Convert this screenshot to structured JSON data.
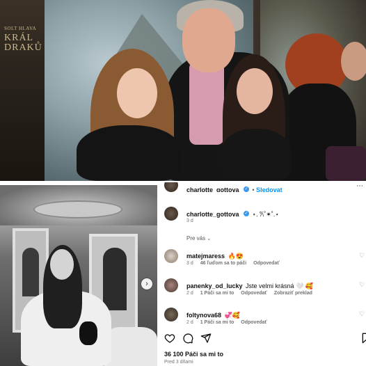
{
  "poster": {
    "title": "KRÁL DRAKŮ",
    "subtitle": "SOLT HLAVA"
  },
  "header": {
    "username": "charlotte_gottova",
    "follow_label": "Sledovat",
    "more_label": "⋯"
  },
  "caption": {
    "username": "charlotte_gottova",
    "text": "⋆. 𐙚˚✶˚.⋆",
    "time": "3 d",
    "show_more": "Pre vás"
  },
  "comments": [
    {
      "username": "matejmaress",
      "text": "🔥😍",
      "time": "3 d",
      "likes": "46 ľuďom sa to páči",
      "reply": "Odpovedať",
      "translate": ""
    },
    {
      "username": "panenky_od_lucky",
      "text": "Jste velmi krásná 🤍 🥰",
      "time": "2 d",
      "likes": "1 Páči sa mi to",
      "reply": "Odpovedať",
      "translate": "Zobraziť preklad"
    },
    {
      "username": "foltynova68",
      "text": "💞🥰",
      "time": "2 d",
      "likes": "1 Páči sa mi to",
      "reply": "Odpovedať",
      "translate": ""
    }
  ],
  "post": {
    "likes": "36 100 Páči sa mi to",
    "date": "Pred 3 dňami"
  },
  "icons": {
    "like": "heart-icon",
    "comment": "comment-icon",
    "share": "share-icon",
    "save": "bookmark-icon",
    "next": "chevron-right-icon"
  },
  "colors": {
    "verified": "#3897f0",
    "meta": "#737373"
  }
}
